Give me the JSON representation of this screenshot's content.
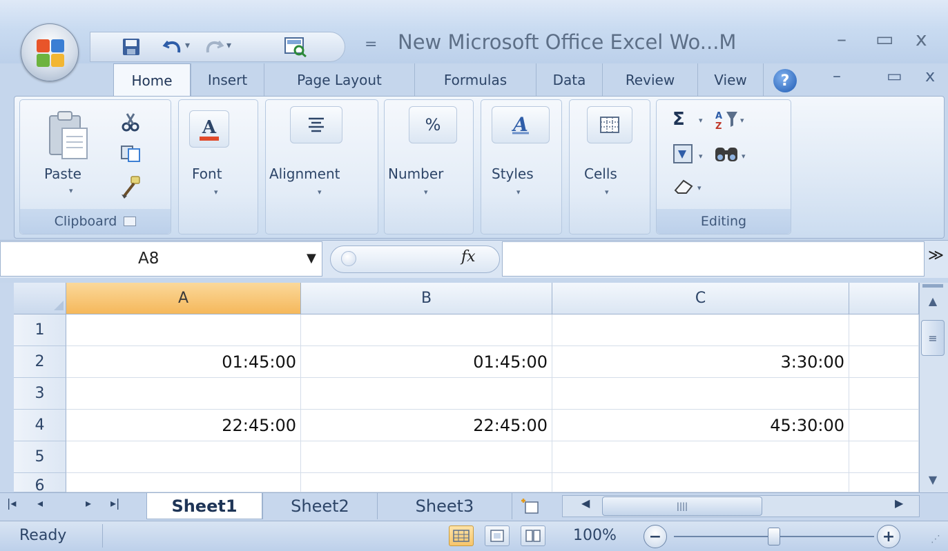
{
  "window": {
    "title": "New Microsoft Office Excel Wo...M",
    "minimize": "–",
    "restore": "▭",
    "close": "x"
  },
  "qat": {
    "icons": [
      "save-icon",
      "undo-icon",
      "redo-icon",
      "print-preview-icon",
      "customize-icon"
    ],
    "dropdown_arrow": "▾",
    "customize": "="
  },
  "ribbon": {
    "tabs": [
      {
        "label": "Home",
        "active": true
      },
      {
        "label": "Insert"
      },
      {
        "label": "Page Layout"
      },
      {
        "label": "Formulas"
      },
      {
        "label": "Data"
      },
      {
        "label": "Review"
      },
      {
        "label": "View"
      }
    ],
    "help": "?",
    "inner_minimize": "–",
    "inner_restore": "▭",
    "inner_close": "x",
    "groups": {
      "clipboard": {
        "label": "Clipboard",
        "paste_label": "Paste"
      },
      "font": {
        "label": "Font"
      },
      "alignment": {
        "label": "Alignment"
      },
      "number": {
        "label": "Number",
        "icon_text": "%"
      },
      "styles": {
        "label": "Styles"
      },
      "cells": {
        "label": "Cells"
      },
      "editing": {
        "label": "Editing",
        "sigma": "Σ"
      }
    }
  },
  "formula_bar": {
    "name_box": "A8",
    "fx": "fx",
    "formula": "",
    "expand": "≫"
  },
  "grid": {
    "columns": [
      "A",
      "B",
      "C"
    ],
    "active_column": "A",
    "rows": [
      {
        "num": "1",
        "cells": [
          "",
          "",
          ""
        ]
      },
      {
        "num": "2",
        "cells": [
          "01:45:00",
          "01:45:00",
          "3:30:00"
        ]
      },
      {
        "num": "3",
        "cells": [
          "",
          "",
          ""
        ]
      },
      {
        "num": "4",
        "cells": [
          "22:45:00",
          "22:45:00",
          "45:30:00"
        ]
      },
      {
        "num": "5",
        "cells": [
          "",
          "",
          ""
        ]
      },
      {
        "num": "6",
        "cells": [
          "",
          "",
          ""
        ]
      }
    ]
  },
  "sheets": {
    "tabs": [
      "Sheet1",
      "Sheet2",
      "Sheet3"
    ],
    "active": "Sheet1",
    "nav": [
      "|◂",
      "◂",
      "▸",
      "▸|"
    ]
  },
  "status": {
    "text": "Ready",
    "zoom": "100%",
    "zoom_minus": "−",
    "zoom_plus": "+"
  },
  "colors": {
    "accent_header": "#f5b85b",
    "ribbon_bg": "#dde8f5",
    "frame": "#9db2cf"
  }
}
